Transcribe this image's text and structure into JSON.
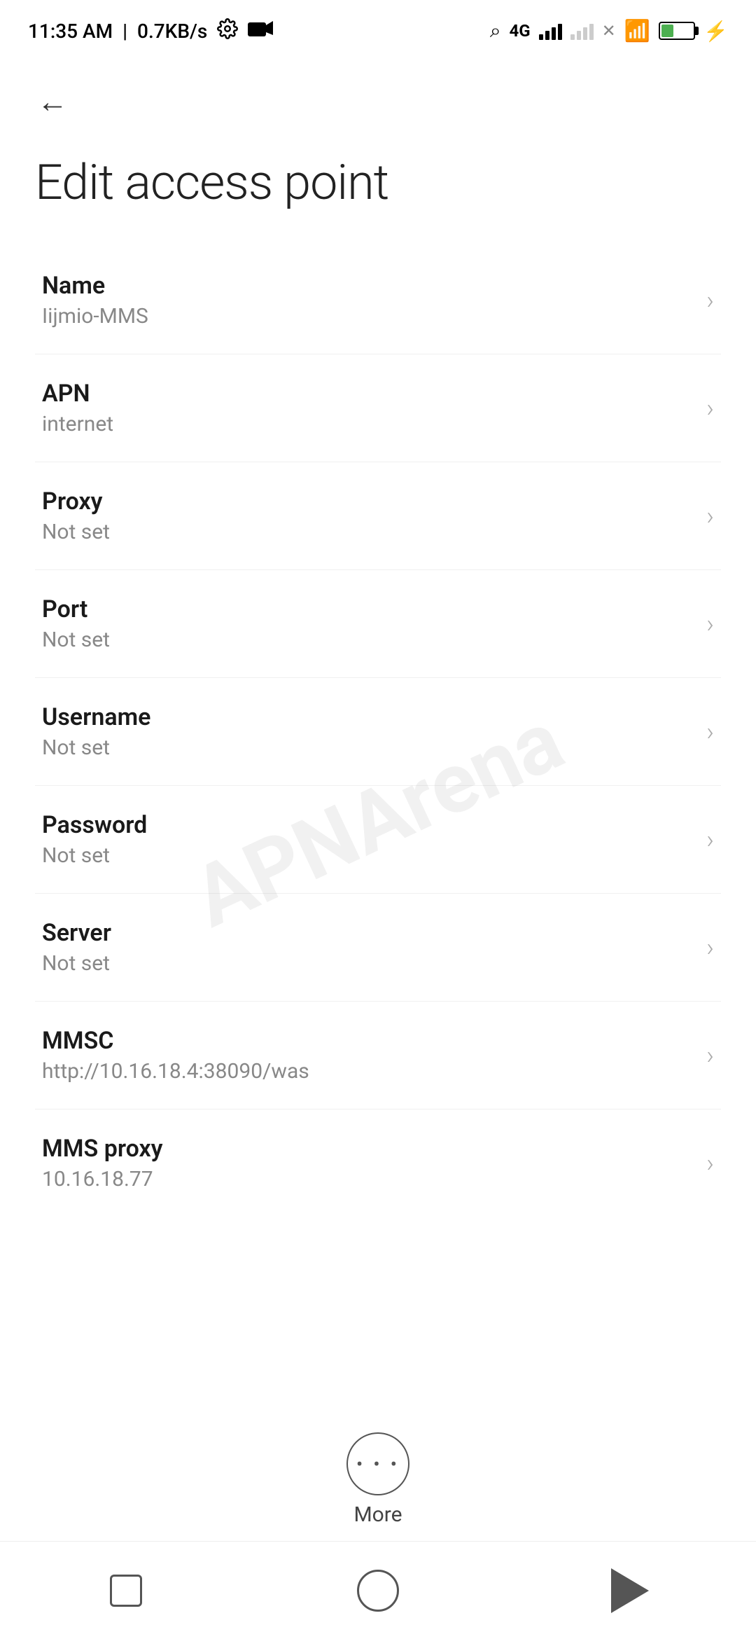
{
  "statusBar": {
    "time": "11:35 AM",
    "network": "0.7KB/s",
    "battery": "38"
  },
  "header": {
    "backLabel": "←",
    "title": "Edit access point"
  },
  "settings": {
    "items": [
      {
        "label": "Name",
        "value": "Iijmio-MMS"
      },
      {
        "label": "APN",
        "value": "internet"
      },
      {
        "label": "Proxy",
        "value": "Not set"
      },
      {
        "label": "Port",
        "value": "Not set"
      },
      {
        "label": "Username",
        "value": "Not set"
      },
      {
        "label": "Password",
        "value": "Not set"
      },
      {
        "label": "Server",
        "value": "Not set"
      },
      {
        "label": "MMSC",
        "value": "http://10.16.18.4:38090/was"
      },
      {
        "label": "MMS proxy",
        "value": "10.16.18.77"
      }
    ]
  },
  "more": {
    "label": "More"
  },
  "watermark": "APNArena"
}
